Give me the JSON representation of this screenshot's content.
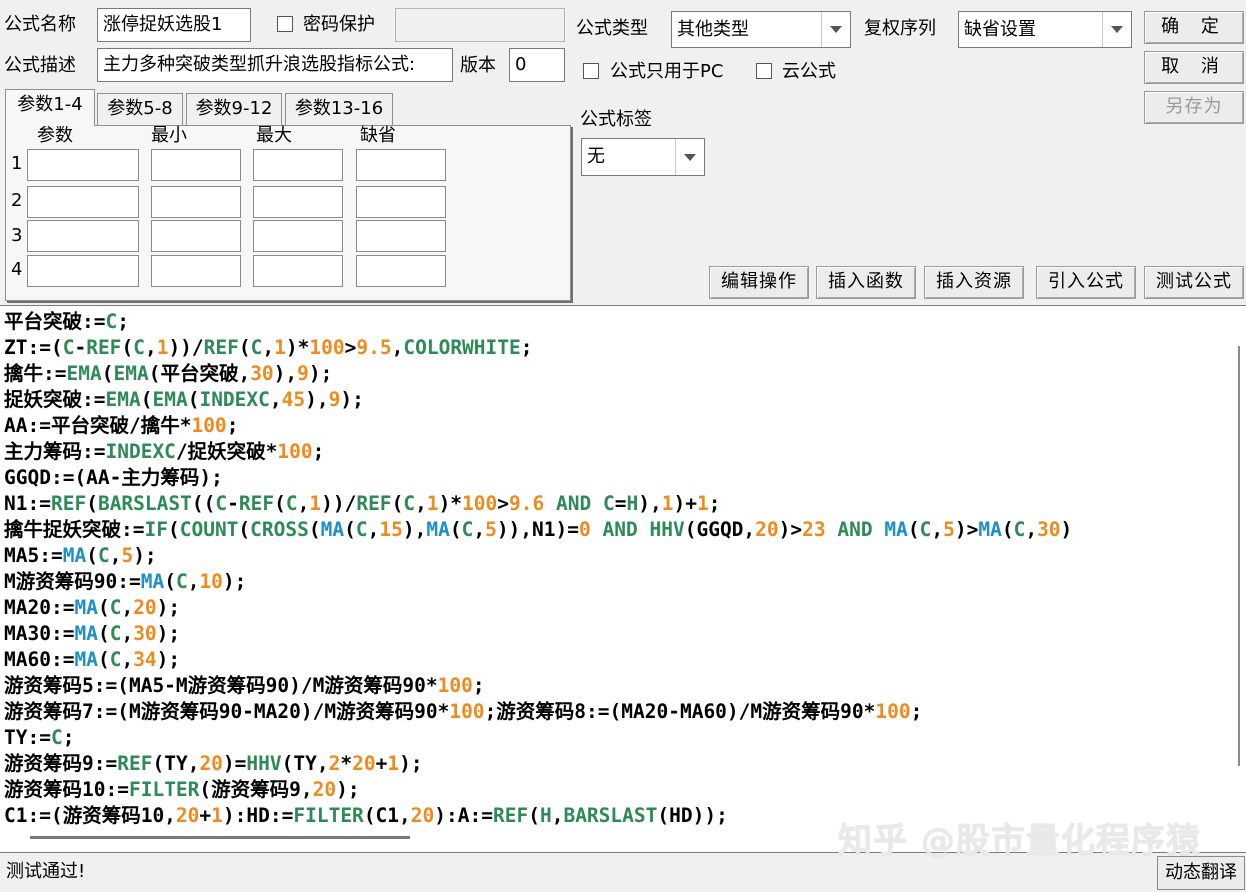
{
  "formula": {
    "name_label": "公式名称",
    "name_value": "涨停捉妖选股1",
    "password_label": "密码保护",
    "password_value": "",
    "desc_label": "公式描述",
    "desc_value": "主力多种突破类型抓升浪选股指标公式:",
    "version_label": "版本",
    "version_value": "0",
    "type_label": "公式类型",
    "type_value": "其他类型",
    "rights_label": "复权序列",
    "rights_value": "缺省设置",
    "pc_only_label": "公式只用于PC",
    "cloud_label": "云公式",
    "tag_label": "公式标签",
    "tag_value": "无"
  },
  "buttons": {
    "ok": "确 定",
    "cancel": "取 消",
    "save_as": "另存为",
    "edit_ops": "编辑操作",
    "insert_fn": "插入函数",
    "insert_res": "插入资源",
    "import_formula": "引入公式",
    "test_formula": "测试公式",
    "dynamic_translate": "动态翻译"
  },
  "tabs": [
    "参数1-4",
    "参数5-8",
    "参数9-12",
    "参数13-16"
  ],
  "param_table": {
    "headers": [
      "参数",
      "最小",
      "最大",
      "缺省"
    ],
    "rows": [
      "1",
      "2",
      "3",
      "4"
    ]
  },
  "code_lines": [
    [
      [
        "t",
        "平台突破:="
      ],
      [
        "c-fn",
        "C"
      ],
      [
        "t",
        ";"
      ]
    ],
    [
      [
        "t",
        "ZT:=("
      ],
      [
        "c-fn",
        "C"
      ],
      [
        "t",
        "-"
      ],
      [
        "c-fn",
        "REF"
      ],
      [
        "t",
        "("
      ],
      [
        "c-fn",
        "C"
      ],
      [
        "t",
        ","
      ],
      [
        "c-num",
        "1"
      ],
      [
        "t",
        "))/"
      ],
      [
        "c-fn",
        "REF"
      ],
      [
        "t",
        "("
      ],
      [
        "c-fn",
        "C"
      ],
      [
        "t",
        ","
      ],
      [
        "c-num",
        "1"
      ],
      [
        "t",
        ")*"
      ],
      [
        "c-num",
        "100"
      ],
      [
        "t",
        ">"
      ],
      [
        "c-num",
        "9.5"
      ],
      [
        "t",
        ","
      ],
      [
        "c-fn",
        "COLORWHITE"
      ],
      [
        "t",
        ";"
      ]
    ],
    [
      [
        "t",
        "擒牛:="
      ],
      [
        "c-fn",
        "EMA"
      ],
      [
        "t",
        "("
      ],
      [
        "c-fn",
        "EMA"
      ],
      [
        "t",
        "(平台突破,"
      ],
      [
        "c-num",
        "30"
      ],
      [
        "t",
        "),"
      ],
      [
        "c-num",
        "9"
      ],
      [
        "t",
        ");"
      ]
    ],
    [
      [
        "t",
        "捉妖突破:="
      ],
      [
        "c-fn",
        "EMA"
      ],
      [
        "t",
        "("
      ],
      [
        "c-fn",
        "EMA"
      ],
      [
        "t",
        "("
      ],
      [
        "c-fn",
        "INDEXC"
      ],
      [
        "t",
        ","
      ],
      [
        "c-num",
        "45"
      ],
      [
        "t",
        "),"
      ],
      [
        "c-num",
        "9"
      ],
      [
        "t",
        ");"
      ]
    ],
    [
      [
        "t",
        "AA:=平台突破/擒牛*"
      ],
      [
        "c-num",
        "100"
      ],
      [
        "t",
        ";"
      ]
    ],
    [
      [
        "t",
        "主力筹码:="
      ],
      [
        "c-fn",
        "INDEXC"
      ],
      [
        "t",
        "/捉妖突破*"
      ],
      [
        "c-num",
        "100"
      ],
      [
        "t",
        ";"
      ]
    ],
    [
      [
        "t",
        "GGQD:=(AA-主力筹码);"
      ]
    ],
    [
      [
        "t",
        "N1:="
      ],
      [
        "c-fn",
        "REF"
      ],
      [
        "t",
        "("
      ],
      [
        "c-fn",
        "BARSLAST"
      ],
      [
        "t",
        "(("
      ],
      [
        "c-fn",
        "C"
      ],
      [
        "t",
        "-"
      ],
      [
        "c-fn",
        "REF"
      ],
      [
        "t",
        "("
      ],
      [
        "c-fn",
        "C"
      ],
      [
        "t",
        ","
      ],
      [
        "c-num",
        "1"
      ],
      [
        "t",
        "))/"
      ],
      [
        "c-fn",
        "REF"
      ],
      [
        "t",
        "("
      ],
      [
        "c-fn",
        "C"
      ],
      [
        "t",
        ","
      ],
      [
        "c-num",
        "1"
      ],
      [
        "t",
        ")*"
      ],
      [
        "c-num",
        "100"
      ],
      [
        "t",
        ">"
      ],
      [
        "c-num",
        "9.6"
      ],
      [
        "t",
        " "
      ],
      [
        "c-kw",
        "AND"
      ],
      [
        "t",
        " "
      ],
      [
        "c-fn",
        "C"
      ],
      [
        "t",
        "="
      ],
      [
        "c-fn",
        "H"
      ],
      [
        "t",
        "),"
      ],
      [
        "c-num",
        "1"
      ],
      [
        "t",
        ")+"
      ],
      [
        "c-num",
        "1"
      ],
      [
        "t",
        ";"
      ]
    ],
    [
      [
        "t",
        "擒牛捉妖突破:="
      ],
      [
        "c-fn",
        "IF"
      ],
      [
        "t",
        "("
      ],
      [
        "c-fn",
        "COUNT"
      ],
      [
        "t",
        "("
      ],
      [
        "c-fn",
        "CROSS"
      ],
      [
        "t",
        "("
      ],
      [
        "c-fn2",
        "MA"
      ],
      [
        "t",
        "("
      ],
      [
        "c-fn",
        "C"
      ],
      [
        "t",
        ","
      ],
      [
        "c-num",
        "15"
      ],
      [
        "t",
        "),"
      ],
      [
        "c-fn2",
        "MA"
      ],
      [
        "t",
        "("
      ],
      [
        "c-fn",
        "C"
      ],
      [
        "t",
        ","
      ],
      [
        "c-num",
        "5"
      ],
      [
        "t",
        ")),N1)="
      ],
      [
        "c-num",
        "0"
      ],
      [
        "t",
        " "
      ],
      [
        "c-kw",
        "AND"
      ],
      [
        "t",
        " "
      ],
      [
        "c-fn",
        "HHV"
      ],
      [
        "t",
        "(GGQD,"
      ],
      [
        "c-num",
        "20"
      ],
      [
        "t",
        ")>"
      ],
      [
        "c-num",
        "23"
      ],
      [
        "t",
        " "
      ],
      [
        "c-kw",
        "AND"
      ],
      [
        "t",
        " "
      ],
      [
        "c-fn2",
        "MA"
      ],
      [
        "t",
        "("
      ],
      [
        "c-fn",
        "C"
      ],
      [
        "t",
        ","
      ],
      [
        "c-num",
        "5"
      ],
      [
        "t",
        ")>"
      ],
      [
        "c-fn2",
        "MA"
      ],
      [
        "t",
        "("
      ],
      [
        "c-fn",
        "C"
      ],
      [
        "t",
        ","
      ],
      [
        "c-num",
        "30"
      ],
      [
        "t",
        ")"
      ]
    ],
    [
      [
        "t",
        "MA5:="
      ],
      [
        "c-fn2",
        "MA"
      ],
      [
        "t",
        "("
      ],
      [
        "c-fn",
        "C"
      ],
      [
        "t",
        ","
      ],
      [
        "c-num",
        "5"
      ],
      [
        "t",
        ");"
      ]
    ],
    [
      [
        "t",
        "M游资筹码90:="
      ],
      [
        "c-fn2",
        "MA"
      ],
      [
        "t",
        "("
      ],
      [
        "c-fn",
        "C"
      ],
      [
        "t",
        ","
      ],
      [
        "c-num",
        "10"
      ],
      [
        "t",
        ");"
      ]
    ],
    [
      [
        "t",
        "MA20:="
      ],
      [
        "c-fn2",
        "MA"
      ],
      [
        "t",
        "("
      ],
      [
        "c-fn",
        "C"
      ],
      [
        "t",
        ","
      ],
      [
        "c-num",
        "20"
      ],
      [
        "t",
        ");"
      ]
    ],
    [
      [
        "t",
        "MA30:="
      ],
      [
        "c-fn2",
        "MA"
      ],
      [
        "t",
        "("
      ],
      [
        "c-fn",
        "C"
      ],
      [
        "t",
        ","
      ],
      [
        "c-num",
        "30"
      ],
      [
        "t",
        ");"
      ]
    ],
    [
      [
        "t",
        "MA60:="
      ],
      [
        "c-fn2",
        "MA"
      ],
      [
        "t",
        "("
      ],
      [
        "c-fn",
        "C"
      ],
      [
        "t",
        ","
      ],
      [
        "c-num",
        "34"
      ],
      [
        "t",
        ");"
      ]
    ],
    [
      [
        "t",
        "游资筹码5:=(MA5-M游资筹码90)/M游资筹码90*"
      ],
      [
        "c-num",
        "100"
      ],
      [
        "t",
        ";"
      ]
    ],
    [
      [
        "t",
        "游资筹码7:=(M游资筹码90-MA20)/M游资筹码90*"
      ],
      [
        "c-num",
        "100"
      ],
      [
        "t",
        ";游资筹码8:=(MA20-MA60)/M游资筹码90*"
      ],
      [
        "c-num",
        "100"
      ],
      [
        "t",
        ";"
      ]
    ],
    [
      [
        "t",
        "TY:="
      ],
      [
        "c-fn",
        "C"
      ],
      [
        "t",
        ";"
      ]
    ],
    [
      [
        "t",
        "游资筹码9:="
      ],
      [
        "c-fn",
        "REF"
      ],
      [
        "t",
        "(TY,"
      ],
      [
        "c-num",
        "20"
      ],
      [
        "t",
        ")="
      ],
      [
        "c-fn",
        "HHV"
      ],
      [
        "t",
        "(TY,"
      ],
      [
        "c-num",
        "2"
      ],
      [
        "t",
        "*"
      ],
      [
        "c-num",
        "20"
      ],
      [
        "t",
        "+"
      ],
      [
        "c-num",
        "1"
      ],
      [
        "t",
        ");"
      ]
    ],
    [
      [
        "t",
        "游资筹码10:="
      ],
      [
        "c-fn",
        "FILTER"
      ],
      [
        "t",
        "(游资筹码9,"
      ],
      [
        "c-num",
        "20"
      ],
      [
        "t",
        ");"
      ]
    ],
    [
      [
        "t",
        "C1:=(游资筹码10,"
      ],
      [
        "c-num",
        "20"
      ],
      [
        "t",
        "+"
      ],
      [
        "c-num",
        "1"
      ],
      [
        "t",
        "):HD:="
      ],
      [
        "c-fn",
        "FILTER"
      ],
      [
        "t",
        "(C1,"
      ],
      [
        "c-num",
        "20"
      ],
      [
        "t",
        "):A:="
      ],
      [
        "c-fn",
        "REF"
      ],
      [
        "t",
        "("
      ],
      [
        "c-fn",
        "H"
      ],
      [
        "t",
        ","
      ],
      [
        "c-fn",
        "BARSLAST"
      ],
      [
        "t",
        "(HD));"
      ]
    ]
  ],
  "watermark": "知乎 @股市量化程序猿",
  "status": "测试通过!"
}
